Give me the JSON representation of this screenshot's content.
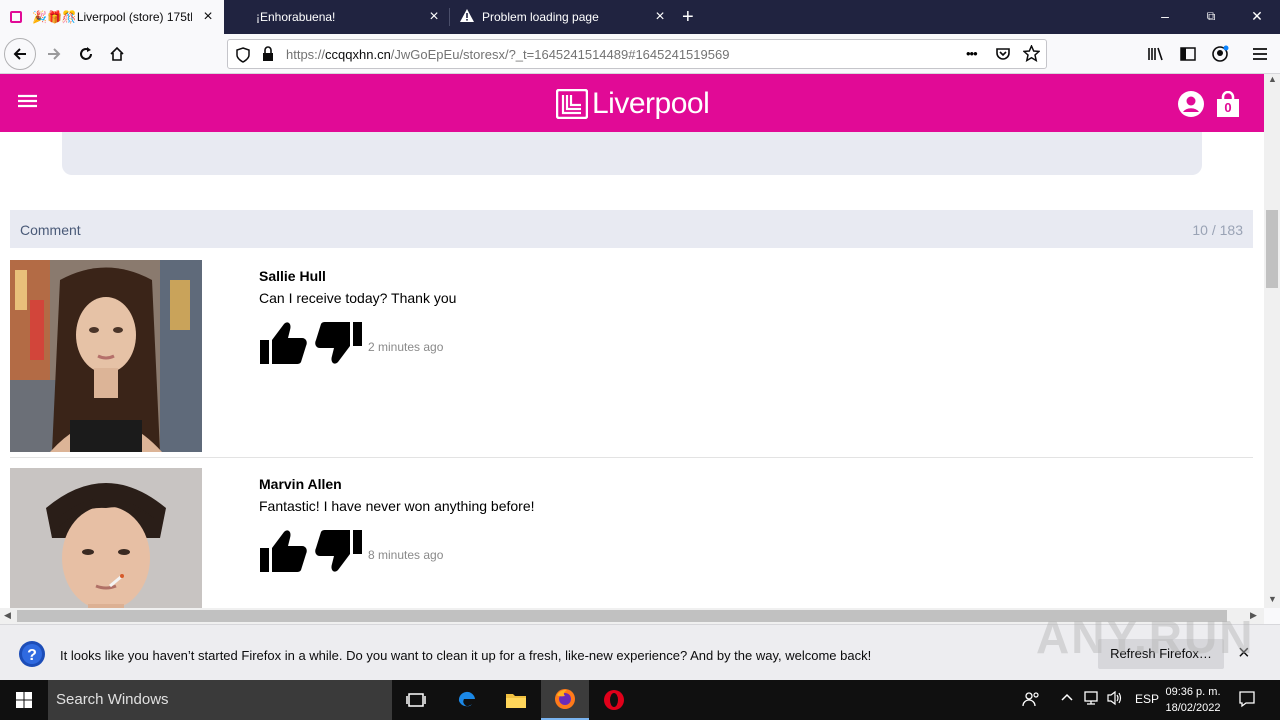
{
  "tabs": [
    {
      "title": "🎉🎁🎊Liverpool (store) 175th",
      "active": true
    },
    {
      "title": "¡Enhorabuena!",
      "active": false
    },
    {
      "title": "Problem loading page",
      "active": false
    }
  ],
  "window_controls": {
    "minimize": "–",
    "restore": "⧉",
    "close": "✕"
  },
  "urlbar": {
    "url_prefix": "https://",
    "url_domain": "ccqqxhn.cn",
    "url_rest": "/JwGoEpEu/storesx/?_t=1645241514489#1645241519569",
    "more": "•••"
  },
  "page": {
    "brand": "Liverpool",
    "brand_color": "#e10a96",
    "cart_count": "0",
    "comment_label": "Comment",
    "comment_count": "10 / 183",
    "comments": [
      {
        "name": "Sallie Hull",
        "text": "Can I receive today? Thank you",
        "time": "2 minutes ago"
      },
      {
        "name": "Marvin Allen",
        "text": "Fantastic! I have never won anything before!",
        "time": "8 minutes ago"
      }
    ]
  },
  "notification": {
    "message": "It looks like you haven’t started Firefox in a while. Do you want to clean it up for a fresh, like-new experience? And by the way, welcome back!",
    "button": "Refresh Firefox…"
  },
  "watermark": "ANY.RUN",
  "taskbar": {
    "search_placeholder": "Search Windows",
    "language": "ESP",
    "time": "09:36 p. m.",
    "date": "18/02/2022"
  }
}
